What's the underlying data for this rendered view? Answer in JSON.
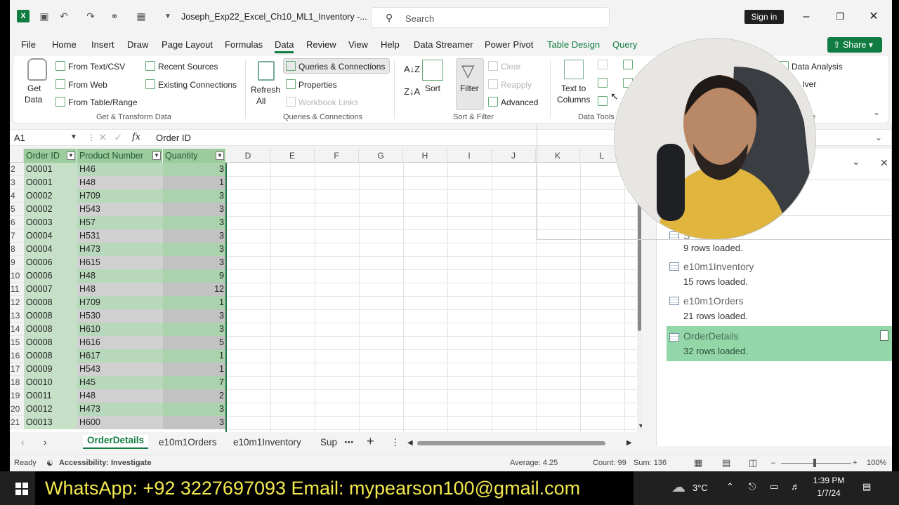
{
  "window": {
    "title": "Joseph_Exp22_Excel_Ch10_ML1_Inventory  -...",
    "search_placeholder": "Search",
    "sign_in": "Sign in"
  },
  "menu_tabs": [
    "File",
    "Home",
    "Insert",
    "Draw",
    "Page Layout",
    "Formulas",
    "Data",
    "Review",
    "View",
    "Help",
    "Data Streamer",
    "Power Pivot"
  ],
  "context_tabs": [
    "Table Design",
    "Query"
  ],
  "share_label": "Share",
  "ribbon": {
    "get_data": "Get",
    "get_data2": "Data",
    "from_text": "From Text/CSV",
    "from_web": "From Web",
    "from_table": "From Table/Range",
    "recent_sources": "Recent Sources",
    "existing_connections": "Existing Connections",
    "group_get": "Get & Transform Data",
    "refresh": "Refresh",
    "refresh2": "All",
    "queries_connections": "Queries & Connections",
    "properties": "Properties",
    "workbook_links": "Workbook Links",
    "group_queries": "Queries & Connections",
    "sort": "Sort",
    "filter": "Filter",
    "clear": "Clear",
    "reapply": "Reapply",
    "advanced": "Advanced",
    "group_sort": "Sort & Filter",
    "text_to_columns": "Text to",
    "text_to_columns2": "Columns",
    "group_tools": "Data Tools",
    "data_analysis": "Data Analysis",
    "solver_partial": "lver",
    "group_partial": "e"
  },
  "formula_bar": {
    "name_box": "A1",
    "value": "Order ID"
  },
  "columns": [
    "D",
    "E",
    "F",
    "G",
    "H",
    "I",
    "J",
    "K",
    "L"
  ],
  "table_headers": [
    "Order ID",
    "Product Number",
    "Quantity"
  ],
  "rows": [
    {
      "n": "2",
      "id": "O0001",
      "pn": "H46",
      "q": "3"
    },
    {
      "n": "3",
      "id": "O0001",
      "pn": "H48",
      "q": "1"
    },
    {
      "n": "4",
      "id": "O0002",
      "pn": "H709",
      "q": "3"
    },
    {
      "n": "5",
      "id": "O0002",
      "pn": "H543",
      "q": "3"
    },
    {
      "n": "6",
      "id": "O0003",
      "pn": "H57",
      "q": "3"
    },
    {
      "n": "7",
      "id": "O0004",
      "pn": "H531",
      "q": "3"
    },
    {
      "n": "8",
      "id": "O0004",
      "pn": "H473",
      "q": "3"
    },
    {
      "n": "9",
      "id": "O0006",
      "pn": "H615",
      "q": "3"
    },
    {
      "n": "10",
      "id": "O0006",
      "pn": "H48",
      "q": "9"
    },
    {
      "n": "11",
      "id": "O0007",
      "pn": "H48",
      "q": "12"
    },
    {
      "n": "12",
      "id": "O0008",
      "pn": "H709",
      "q": "1"
    },
    {
      "n": "13",
      "id": "O0008",
      "pn": "H530",
      "q": "3"
    },
    {
      "n": "14",
      "id": "O0008",
      "pn": "H610",
      "q": "3"
    },
    {
      "n": "15",
      "id": "O0008",
      "pn": "H616",
      "q": "5"
    },
    {
      "n": "16",
      "id": "O0008",
      "pn": "H617",
      "q": "1"
    },
    {
      "n": "17",
      "id": "O0009",
      "pn": "H543",
      "q": "1"
    },
    {
      "n": "18",
      "id": "O0010",
      "pn": "H45",
      "q": "7"
    },
    {
      "n": "19",
      "id": "O0011",
      "pn": "H48",
      "q": "2"
    },
    {
      "n": "20",
      "id": "O0012",
      "pn": "H473",
      "q": "3"
    },
    {
      "n": "21",
      "id": "O0013",
      "pn": "H600",
      "q": "3"
    }
  ],
  "sheet_tabs": [
    "OrderDetails",
    "e10m1Orders",
    "e10m1Inventory",
    "Sup"
  ],
  "queries": [
    {
      "name": "S",
      "rows": "9 rows loaded."
    },
    {
      "name": "e10m1Inventory",
      "rows": "15 rows loaded."
    },
    {
      "name": "e10m1Orders",
      "rows": "21 rows loaded."
    },
    {
      "name": "OrderDetails",
      "rows": "32 rows loaded."
    }
  ],
  "status": {
    "ready": "Ready",
    "accessibility": "Accessibility: Investigate",
    "average": "Average: 4.25",
    "count": "Count: 99",
    "sum": "Sum: 136",
    "zoom": "100%"
  },
  "banner": "WhatsApp: +92 3227697093  Email: mypearson100@gmail.com",
  "taskbar": {
    "weather": "3°C",
    "time": "1:39 PM",
    "date": "1/7/24"
  },
  "colors": {
    "excel_green": "#107c41",
    "table_header": "#9ccb9e",
    "table_row": "#c6e0c8",
    "selected_query": "#93d7a9",
    "banner_text": "#f3e94e"
  }
}
